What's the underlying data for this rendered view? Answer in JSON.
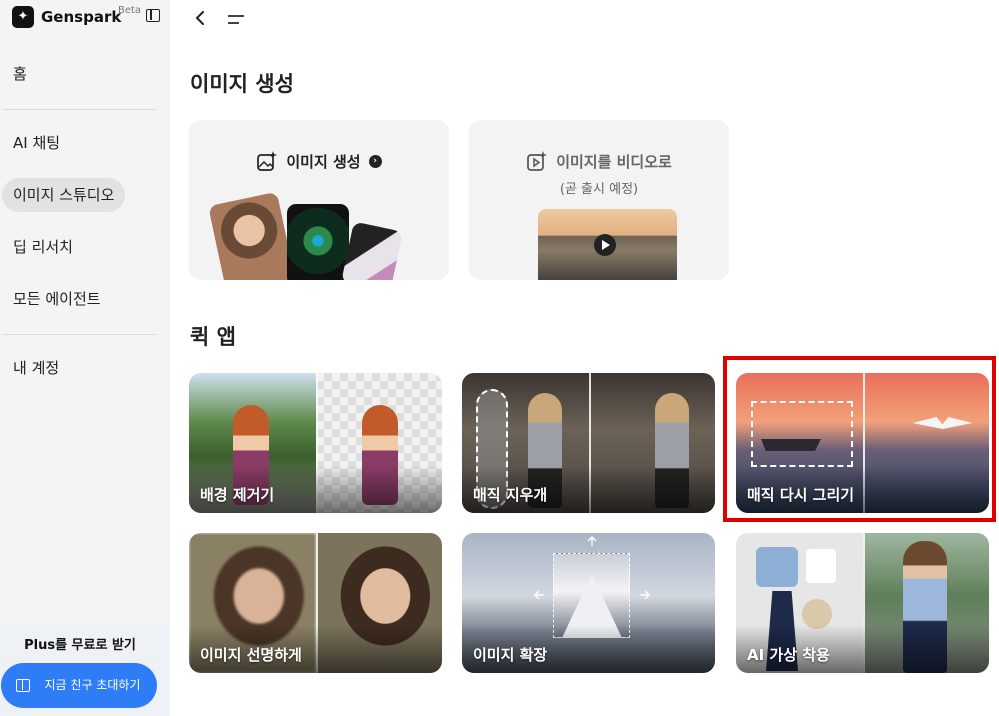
{
  "sidebar": {
    "brand": "Genspark",
    "beta": "Beta",
    "items": [
      {
        "label": "홈"
      },
      {
        "label": "AI 채팅"
      },
      {
        "label": "이미지 스튜디오"
      },
      {
        "label": "딥 리서치"
      },
      {
        "label": "모든 에이전트"
      },
      {
        "label": "내 계정"
      }
    ],
    "plus_title": "Plus를 무료로 받기",
    "invite_label": "지금 친구 초대하기"
  },
  "main": {
    "generation_title": "이미지 생성",
    "cards": [
      {
        "label": "이미지 생성",
        "sub": ""
      },
      {
        "label": "이미지를 비디오로",
        "sub": "(곧 출시 예정)"
      }
    ],
    "quick_title": "퀵 앱",
    "quick_apps": [
      {
        "label": "배경 제거기"
      },
      {
        "label": "매직 지우개"
      },
      {
        "label": "매직 다시 그리기"
      },
      {
        "label": "이미지 선명하게"
      },
      {
        "label": "이미지 확장"
      },
      {
        "label": "AI 가상 착용"
      }
    ]
  },
  "colors": {
    "accent_blue": "#2e7df6",
    "highlight_red": "#e00000",
    "sidebar_bg": "#f4f4f4"
  }
}
